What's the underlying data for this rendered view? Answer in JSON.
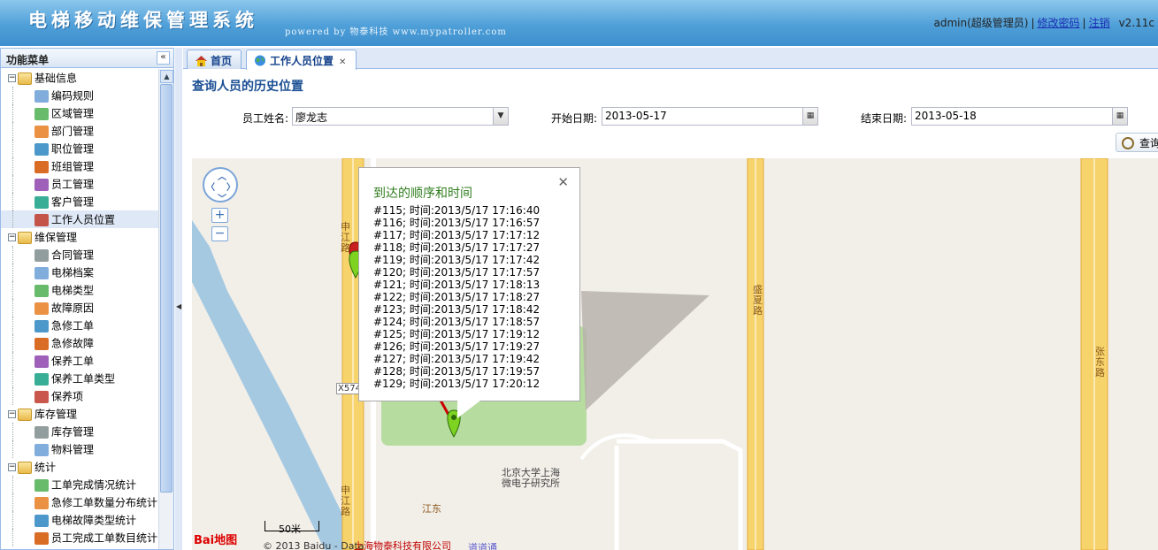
{
  "header": {
    "title": "电梯移动维保管理系统",
    "powered_by": "powered by 物泰科技 www.mypatroller.com",
    "user": "admin(超级管理员)",
    "change_password": "修改密码",
    "logout": "注销",
    "version": "v2.11c"
  },
  "sidebar": {
    "title": "功能菜单",
    "groups": [
      {
        "label": "基础信息",
        "items": [
          "编码规则",
          "区域管理",
          "部门管理",
          "职位管理",
          "班组管理",
          "员工管理",
          "客户管理",
          "工作人员位置"
        ]
      },
      {
        "label": "维保管理",
        "items": [
          "合同管理",
          "电梯档案",
          "电梯类型",
          "故障原因",
          "急修工单",
          "急修故障",
          "保养工单",
          "保养工单类型",
          "保养项"
        ]
      },
      {
        "label": "库存管理",
        "items": [
          "库存管理",
          "物料管理"
        ]
      },
      {
        "label": "统计",
        "items": [
          "工单完成情况统计",
          "急修工单数量分布统计",
          "电梯故障类型统计",
          "员工完成工单数目统计"
        ]
      }
    ],
    "selected": "工作人员位置"
  },
  "tabs": [
    {
      "label": "首页"
    },
    {
      "label": "工作人员位置"
    }
  ],
  "form": {
    "section_title": "查询人员的历史位置",
    "employee_label": "员工姓名:",
    "employee_value": "廖龙志",
    "start_label": "开始日期:",
    "start_value": "2013-05-17",
    "end_label": "结束日期:",
    "end_value": "2013-05-18",
    "query_button": "查询"
  },
  "map": {
    "info_title": "到达的顺序和时间",
    "visits": [
      "#115; 时间:2013/5/17 17:16:40",
      "#116; 时间:2013/5/17 17:16:57",
      "#117; 时间:2013/5/17 17:17:12",
      "#118; 时间:2013/5/17 17:17:27",
      "#119; 时间:2013/5/17 17:17:42",
      "#120; 时间:2013/5/17 17:17:57",
      "#121; 时间:2013/5/17 17:18:13",
      "#122; 时间:2013/5/17 17:18:27",
      "#123; 时间:2013/5/17 17:18:42",
      "#124; 时间:2013/5/17 17:18:57",
      "#125; 时间:2013/5/17 17:19:12",
      "#126; 时间:2013/5/17 17:19:27",
      "#127; 时间:2013/5/17 17:19:42",
      "#128; 时间:2013/5/17 17:19:57",
      "#129; 时间:2013/5/17 17:20:12"
    ],
    "roads": {
      "shenjiang_top": "申江路",
      "shenjiang_bottom": "申江路",
      "shengxia": "盛夏路",
      "zhangdong": "张东路",
      "x574": "X574",
      "poi": "北京大学上海微电子研究所",
      "jiangdong": "江东"
    },
    "scale": "50米",
    "copyright": "© 2013 Baidu - Data",
    "company": "上海物泰科技有限公司",
    "daodao": "道道通",
    "baidu": "Bai地图"
  },
  "colors": {
    "header": "#4f9fd8",
    "accent": "#15428b",
    "marker_green": "#7ed321",
    "road_yellow": "#f7d36b",
    "water": "#a6c9e2"
  }
}
